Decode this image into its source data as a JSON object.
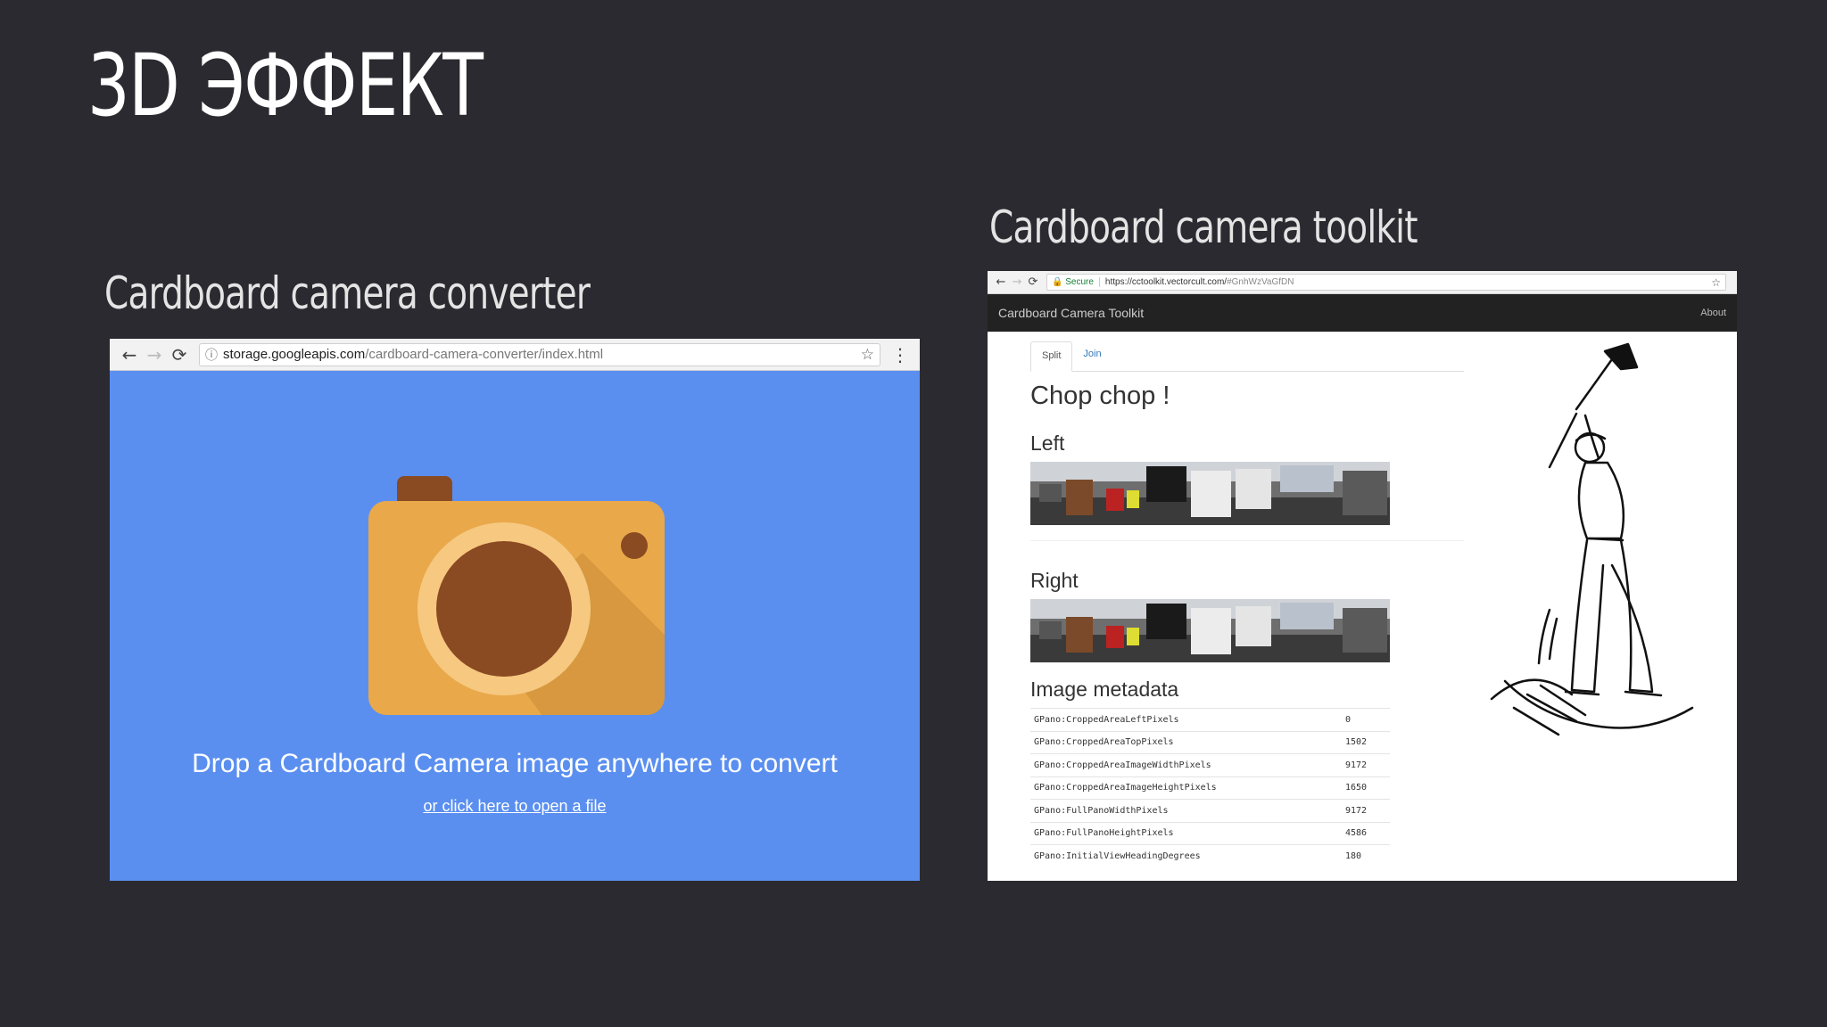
{
  "slide": {
    "title": "3D ЭФФЕКТ",
    "caption_left": "Cardboard camera converter",
    "caption_right": "Cardboard camera toolkit"
  },
  "converter": {
    "url_host": "storage.googleapis.com",
    "url_path": "/cardboard-camera-converter/index.html",
    "drop_text": "Drop a Cardboard Camera image anywhere to convert",
    "open_link": "or click here to open a file",
    "icons": [
      "back-arrow",
      "forward-arrow",
      "reload",
      "info",
      "star",
      "menu-dots",
      "camera"
    ],
    "colors": {
      "background": "#5a8ff0",
      "camera_body": "#e9a84a",
      "camera_lens": "#8a4a22"
    }
  },
  "toolkit": {
    "secure_label": "Secure",
    "url_host": "https://cctoolkit.vectorcult.com/",
    "url_hash": "#GnhWzVaGfDN",
    "navbar_title": "Cardboard Camera Toolkit",
    "about_label": "About",
    "tabs": [
      {
        "label": "Split",
        "active": true
      },
      {
        "label": "Join",
        "active": false
      }
    ],
    "heading": "Chop chop !",
    "left_label": "Left",
    "right_label": "Right",
    "metadata_heading": "Image metadata",
    "metadata": [
      {
        "key": "GPano:CroppedAreaLeftPixels",
        "value": "0"
      },
      {
        "key": "GPano:CroppedAreaTopPixels",
        "value": "1502"
      },
      {
        "key": "GPano:CroppedAreaImageWidthPixels",
        "value": "9172"
      },
      {
        "key": "GPano:CroppedAreaImageHeightPixels",
        "value": "1650"
      },
      {
        "key": "GPano:FullPanoWidthPixels",
        "value": "9172"
      },
      {
        "key": "GPano:FullPanoHeightPixels",
        "value": "4586"
      },
      {
        "key": "GPano:InitialViewHeadingDegrees",
        "value": "180"
      }
    ]
  }
}
